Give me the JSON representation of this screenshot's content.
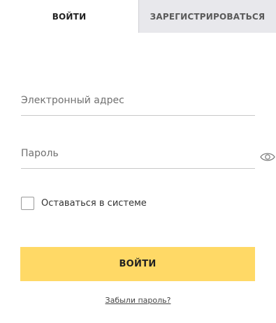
{
  "tabs": {
    "login": "ВОЙТИ",
    "register": "ЗАРЕГИСТРИРОВАТЬСЯ"
  },
  "form": {
    "email_placeholder": "Электронный адрес",
    "email_value": "",
    "password_placeholder": "Пароль",
    "password_value": "",
    "remember_label": "Оставаться в системе",
    "remember_checked": false,
    "submit_label": "ВОЙТИ",
    "forgot_link": "Забыли пароль?"
  },
  "icons": {
    "password_toggle": "eye-icon"
  },
  "colors": {
    "accent": "#ffd966",
    "inactive_tab": "#e8e8ec"
  }
}
